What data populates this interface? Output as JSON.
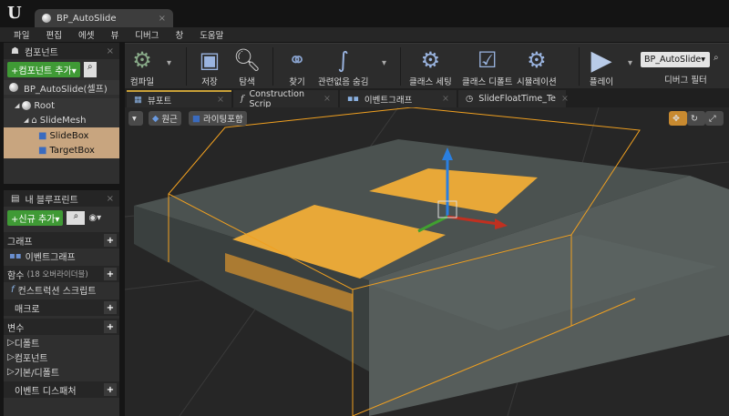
{
  "app": {
    "logo": "U",
    "doc_tab": "BP_AutoSlide",
    "close": "×"
  },
  "menu": [
    "파일",
    "편집",
    "에셋",
    "뷰",
    "디버그",
    "창",
    "도움말"
  ],
  "components": {
    "title": "컴포넌트",
    "add_button": "+컴포넌트 추가▾",
    "self": "BP_AutoSlide(셀프)",
    "tree": [
      "Root",
      "SlideMesh",
      "SlideBox",
      "TargetBox"
    ]
  },
  "my_blueprint": {
    "title": "내 블루프린트",
    "add_button": "+신규 추가▾",
    "sections": {
      "graph": "그래프",
      "event_graph": "이벤트그래프",
      "functions": "함수",
      "functions_note": "(18 오버라이더블)",
      "construction": "컨스트럭션 스크립트",
      "macros": "매크로",
      "variables": "변수",
      "var_default": "디폴트",
      "var_components": "컴포넌트",
      "var_base": "기본/디폴트",
      "dispatchers": "이벤트 디스패처"
    }
  },
  "toolbar": {
    "compile": "컴파일",
    "save": "저장",
    "browse": "탐색",
    "find": "찾기",
    "hide_unrelated": "관련없음 숨김",
    "class_settings": "클래스 세팅",
    "class_defaults": "클래스 디폴트",
    "simulation": "시뮬레이션",
    "play": "플레이",
    "debug_object": "BP_AutoSlide▾",
    "debug_filter": "디버그 필터"
  },
  "tabs": [
    "뷰포트",
    "Construction Scrip",
    "이벤트그래프",
    "SlideFloatTime_Te"
  ],
  "viewport": {
    "perspective": "원근",
    "lighting": "라이팅포함"
  },
  "colors": {
    "accent_green": "#3f9a35",
    "selection": "#c8a57f",
    "bounds": "#f0a020",
    "highlight": "#e8a838"
  }
}
